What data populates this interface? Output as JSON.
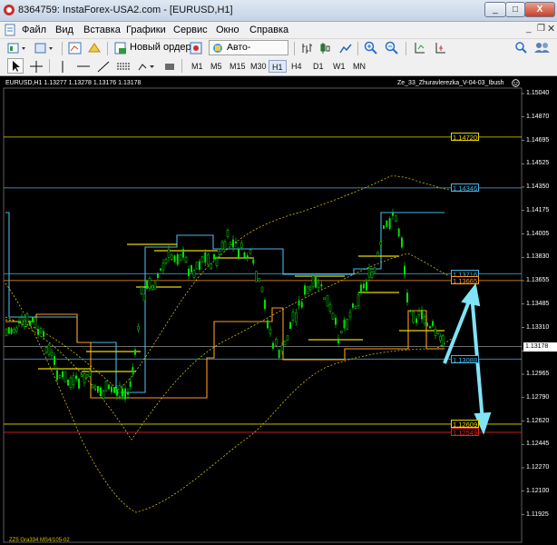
{
  "window": {
    "title": "8364759: InstaForex-USA2.com - [EURUSD,H1]",
    "minimize": "_",
    "maximize": "□",
    "close": "X"
  },
  "menu": [
    "Файл",
    "Вид",
    "Вставка",
    "Графики",
    "Сервис",
    "Окно",
    "Справка"
  ],
  "toolbar": {
    "new_order": "Новый ордер",
    "autotrade": "Авто-торговля",
    "timeframes": [
      "M1",
      "M5",
      "M15",
      "M30",
      "H1",
      "H4",
      "D1",
      "W1",
      "MN"
    ],
    "active_timeframe": "H1"
  },
  "chart": {
    "symbol_info": "EURUSD,H1  1.13277 1.13278 1.13176 1.13178",
    "indicator_name": "Ze_33_Zhuravlerezka_V-04-03_Ibush",
    "current_price": "1.13178",
    "price_axis": [
      "1.15040",
      "1.14870",
      "1.14695",
      "1.14525",
      "1.14350",
      "1.14175",
      "1.14005",
      "1.13830",
      "1.13655",
      "1.13485",
      "1.13310",
      "1.13140",
      "1.12965",
      "1.12790",
      "1.12620",
      "1.12445",
      "1.12270",
      "1.12100",
      "1.11925"
    ],
    "levels": [
      {
        "label": "1.14720",
        "color": "#e8d800"
      },
      {
        "label": "1.14346",
        "color": "#49b7e6"
      },
      {
        "label": "1.13716",
        "color": "#49b7e6"
      },
      {
        "label": "1.13665",
        "color": "#ff9a1a"
      },
      {
        "label": "1.13088",
        "color": "#49b7e6"
      },
      {
        "label": "1.12609",
        "color": "#e8d800"
      },
      {
        "label": "1.12549",
        "color": "#e02020"
      }
    ],
    "footer": "ZZ5 Gra334 MS4/105-02",
    "colors": {
      "candle": "#00e000",
      "ma_upper": "#e8d800",
      "cyan_line": "#49b7e6",
      "orange_line": "#ff9a1a",
      "arrow": "#7fe4f6"
    }
  }
}
